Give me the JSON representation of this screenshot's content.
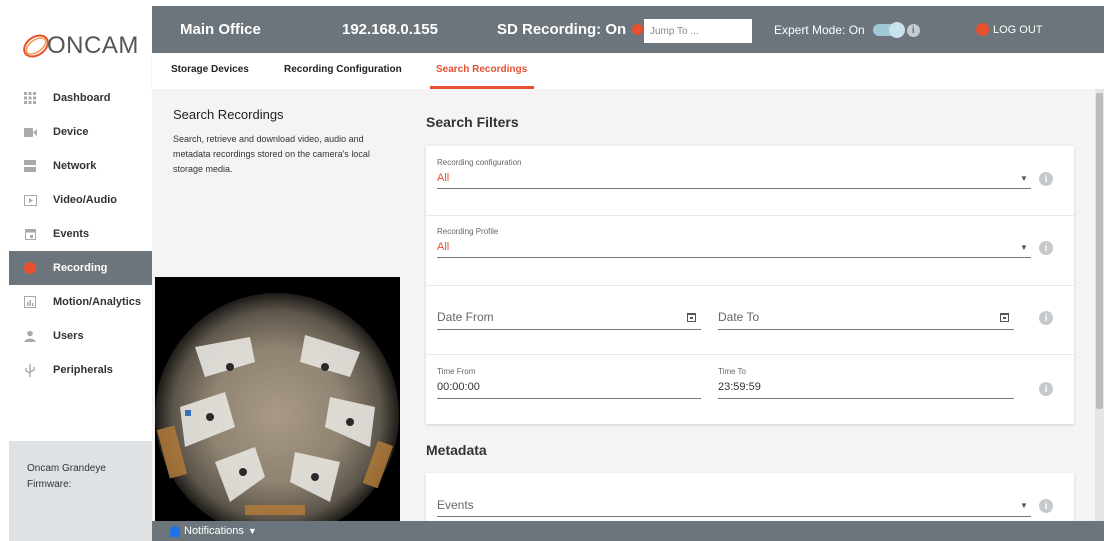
{
  "brand": {
    "name": "ONCAM",
    "accent": "#e8502f"
  },
  "sidebar": {
    "items": [
      {
        "label": "Dashboard",
        "icon": "grid-icon"
      },
      {
        "label": "Device",
        "icon": "camera-icon"
      },
      {
        "label": "Network",
        "icon": "network-icon"
      },
      {
        "label": "Video/Audio",
        "icon": "video-icon"
      },
      {
        "label": "Events",
        "icon": "calendar-icon"
      },
      {
        "label": "Recording",
        "icon": "record-icon",
        "active": true
      },
      {
        "label": "Motion/Analytics",
        "icon": "chart-icon"
      },
      {
        "label": "Users",
        "icon": "user-icon"
      },
      {
        "label": "Peripherals",
        "icon": "usb-icon"
      }
    ],
    "firmware": {
      "line1": "Oncam Grandeye",
      "line2": "Firmware:"
    }
  },
  "header": {
    "title": "Main Office",
    "ip": "192.168.0.155",
    "sd_recording": "SD Recording: On",
    "jump_placeholder": "Jump To ...",
    "expert_mode": "Expert Mode: On",
    "logout": "LOG OUT"
  },
  "tabs": [
    {
      "label": "Storage Devices"
    },
    {
      "label": "Recording Configuration"
    },
    {
      "label": "Search Recordings",
      "active": true
    }
  ],
  "intro": {
    "title": "Search Recordings",
    "text": "Search, retrieve and download video, audio and metadata recordings stored on the camera's local storage media."
  },
  "filters": {
    "title": "Search Filters",
    "recording_configuration": {
      "label": "Recording configuration",
      "value": "All"
    },
    "recording_profile": {
      "label": "Recording Profile",
      "value": "All"
    },
    "date_from": "Date From",
    "date_to": "Date To",
    "time_from": {
      "label": "Time From",
      "value": "00:00:00"
    },
    "time_to": {
      "label": "Time To",
      "value": "23:59:59"
    }
  },
  "metadata": {
    "title": "Metadata",
    "events": "Events"
  },
  "notifications": {
    "label": "Notifications"
  }
}
